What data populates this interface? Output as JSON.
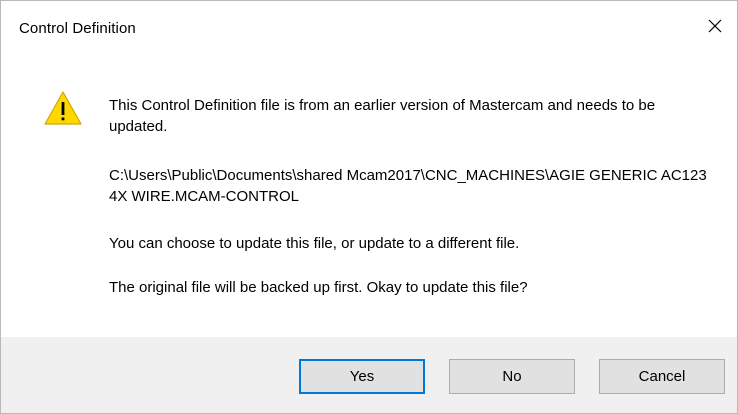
{
  "window": {
    "title": "Control Definition",
    "close_icon": "close-icon"
  },
  "message": {
    "icon": "warning-icon",
    "icon_color": "#ffd800",
    "line_1": "This Control Definition file is from an earlier version of Mastercam and needs to be updated.",
    "path": "C:\\Users\\Public\\Documents\\shared Mcam2017\\CNC_MACHINES\\AGIE GENERIC AC123 4X WIRE.MCAM-CONTROL",
    "line_3": "You can choose to update this file, or update to a different file.",
    "line_4": "The original file will be backed up first.  Okay to update this file?"
  },
  "buttons": {
    "yes_label": "Yes",
    "no_label": "No",
    "cancel_label": "Cancel",
    "default_border_color": "#0078d7"
  }
}
